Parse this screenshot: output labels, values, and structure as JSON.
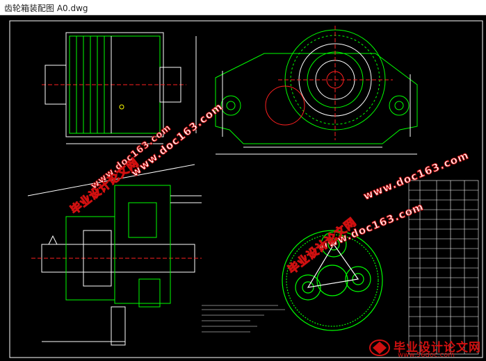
{
  "window": {
    "title": "齿轮箱装配图 A0.dwg"
  },
  "watermarks": {
    "cn": "毕业设计论文网",
    "url_doc": "www.doc163.com"
  },
  "logo": {
    "brand": "毕业设计论文网",
    "site": "www.56doc.com"
  },
  "colors": {
    "background": "#000000",
    "line_green": "#00ff00",
    "line_white": "#ffffff",
    "line_red": "#ff2020",
    "line_cyan": "#00ffff",
    "line_yellow": "#ffff00",
    "watermark_red": "#d01010"
  }
}
